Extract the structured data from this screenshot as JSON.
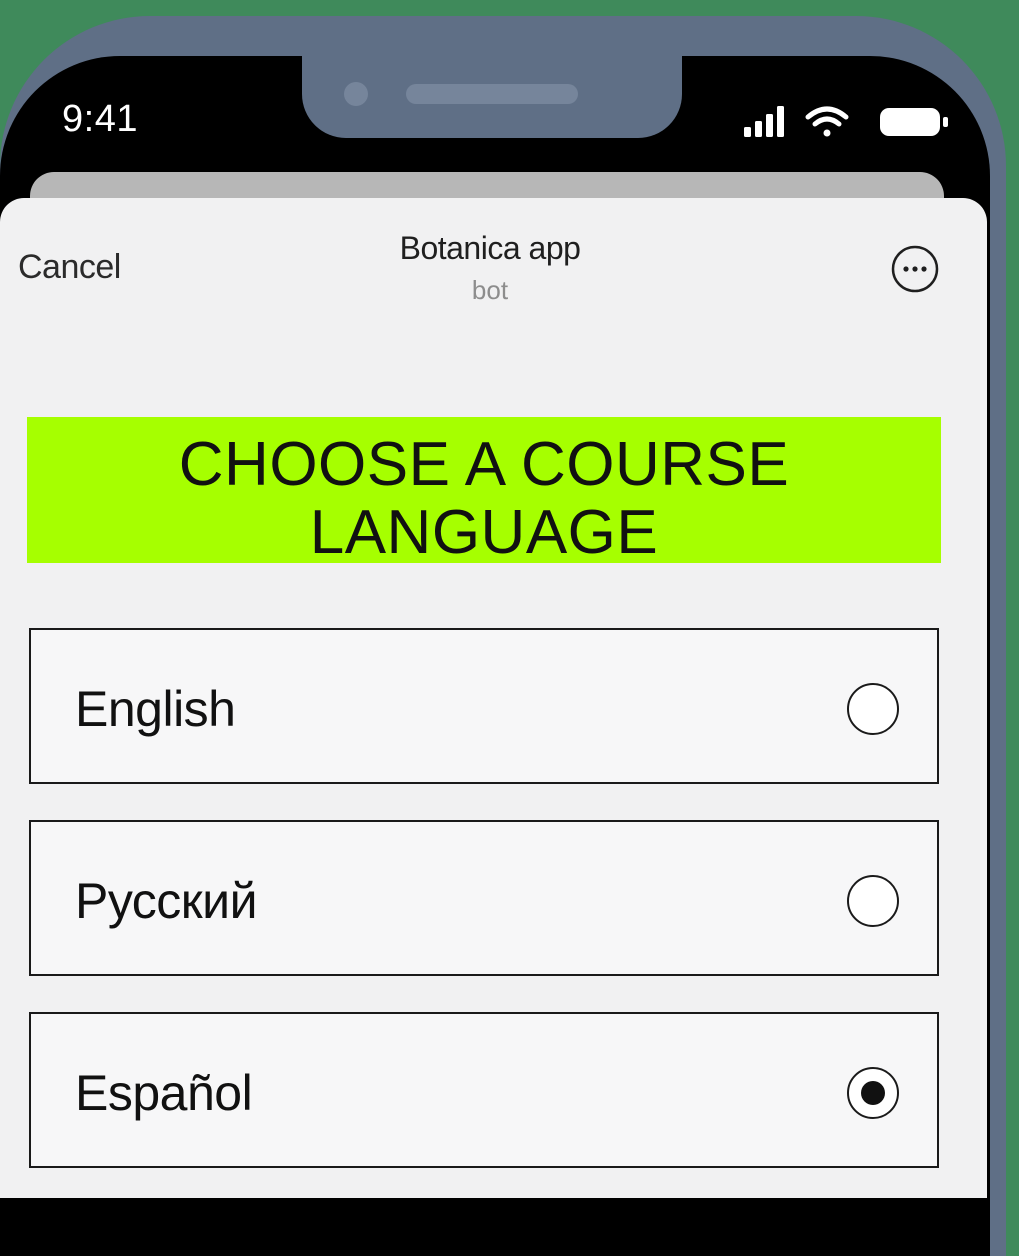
{
  "status_bar": {
    "time": "9:41",
    "icons": [
      "cellular-signal-icon",
      "wifi-icon",
      "battery-icon"
    ]
  },
  "header": {
    "cancel_label": "Cancel",
    "title": "Botanica app",
    "subtitle": "bot",
    "more_icon": "more-horizontal-circle-icon"
  },
  "banner": {
    "title": "CHOOSE A COURSE\nLANGUAGE",
    "background_color": "#a6ff00"
  },
  "options": [
    {
      "label": "English",
      "selected": false
    },
    {
      "label": "Русский",
      "selected": false
    },
    {
      "label": "Español",
      "selected": true
    }
  ],
  "colors": {
    "background": "#3f8a5b",
    "phone_frame": "#5f6f86",
    "accent": "#a6ff00"
  }
}
